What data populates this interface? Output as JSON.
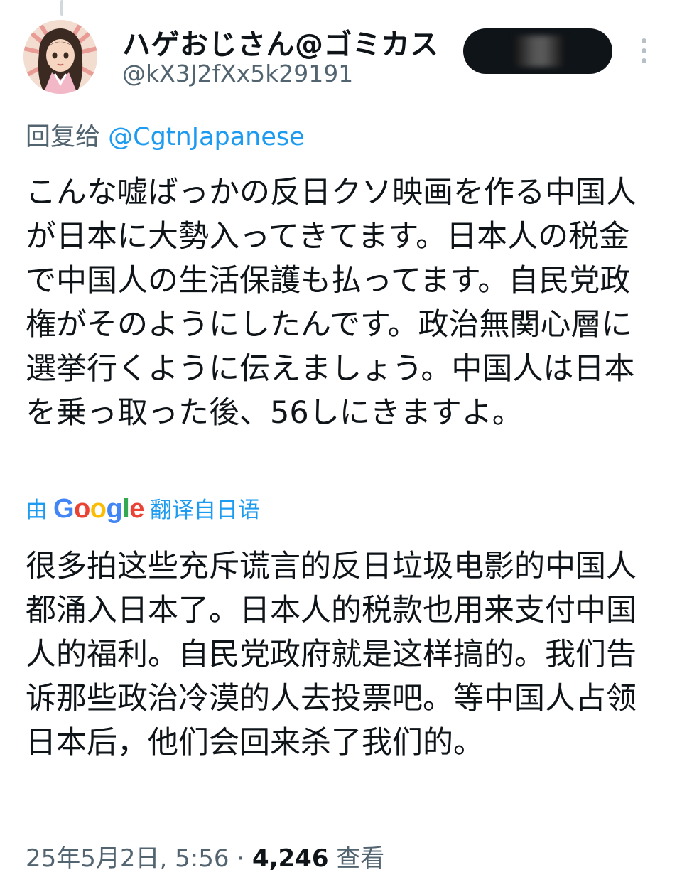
{
  "user": {
    "display_name": "ハゲおじさん@ゴミカス",
    "handle": "@kX3J2fXx5k29191",
    "avatar_icon": "anime-woman-kimono-avatar"
  },
  "reply": {
    "prefix": "回复给",
    "mention": "@CgtnJapanese"
  },
  "tweet": {
    "original_text": "こんな嘘ばっかの反日クソ映画を作る中国人が日本に大勢入ってきてます。日本人の税金で中国人の生活保護も払ってます。自民党政権がそのようにしたんです。政治無関心層に選挙行くように伝えましょう。中国人は日本を乗っ取った後、56しにきますよ。",
    "translated_text": "很多拍这些充斥谎言的反日垃圾电影的中国人都涌入日本了。日本人的税款也用来支付中国人的福利。自民党政府就是这样搞的。我们告诉那些政治冷漠的人去投票吧。等中国人占领日本后，他们会回来杀了我们的。"
  },
  "translation": {
    "prefix": "由",
    "brand": "Google",
    "suffix": "翻译自日语"
  },
  "meta": {
    "timestamp": "25年5月2日, 5:56",
    "separator": "·",
    "views_count": "4,246",
    "views_label": "查看"
  },
  "colors": {
    "link": "#1d9bf0",
    "secondary_text": "#536471",
    "primary_text": "#0f1419"
  }
}
